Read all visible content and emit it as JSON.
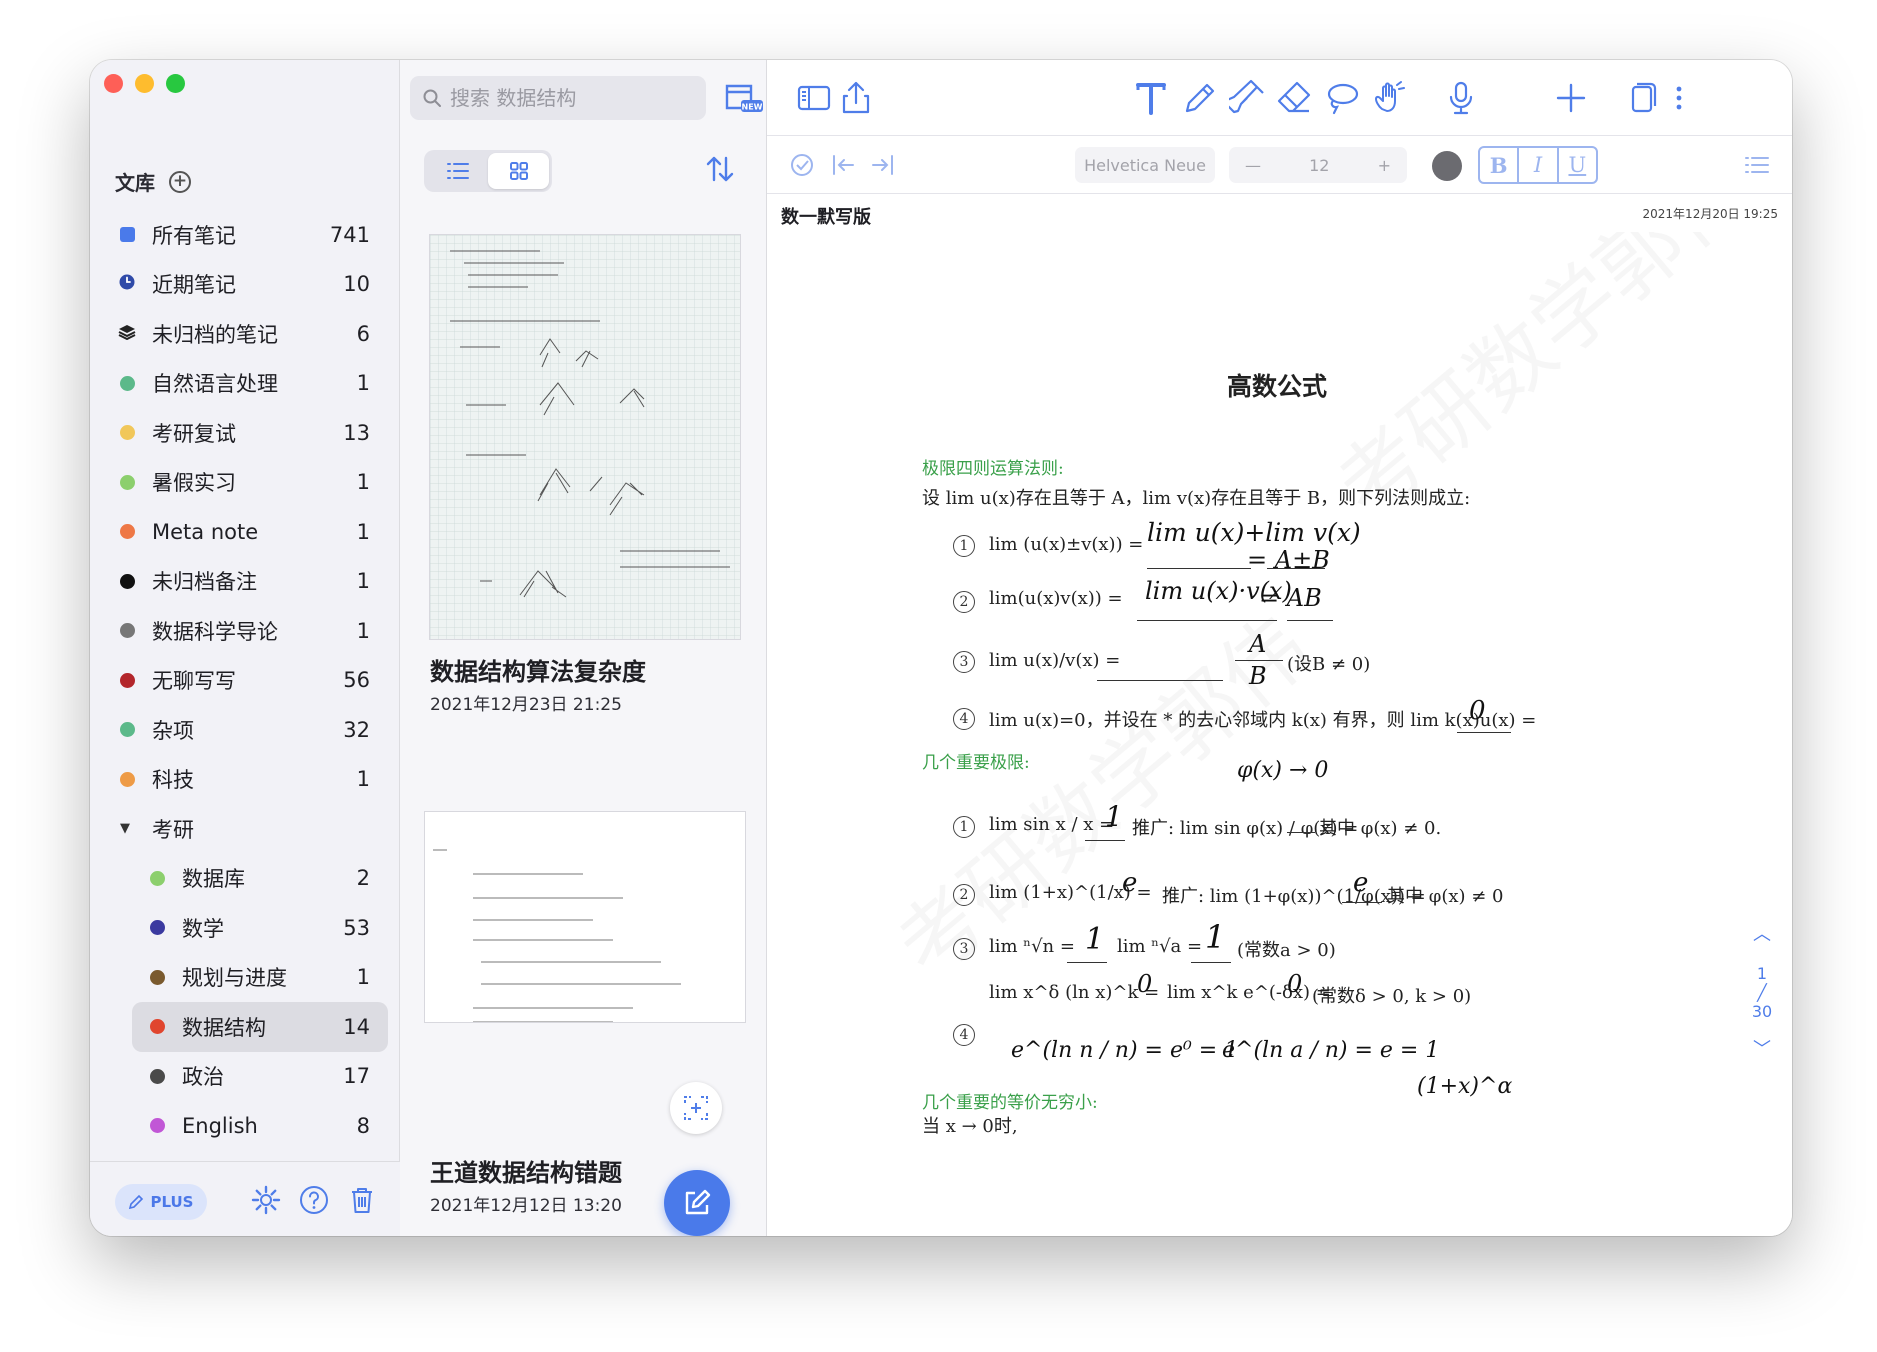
{
  "sidebar": {
    "library_label": "文库",
    "items": [
      {
        "label": "所有笔记",
        "count": "741",
        "marker": "square",
        "color": "#4a7aea"
      },
      {
        "label": "近期笔记",
        "count": "10",
        "marker": "clock",
        "color": "#2f4aa8"
      },
      {
        "label": "未归档的笔记",
        "count": "6",
        "marker": "stack",
        "color": "#222222"
      },
      {
        "label": "自然语言处理",
        "count": "1",
        "marker": "dot",
        "color": "#5cb98a"
      },
      {
        "label": "考研复试",
        "count": "13",
        "marker": "dot",
        "color": "#f1c75a"
      },
      {
        "label": "暑假实习",
        "count": "1",
        "marker": "dot",
        "color": "#8ccf6d"
      },
      {
        "label": "Meta note",
        "count": "1",
        "marker": "dot",
        "color": "#ee7846"
      },
      {
        "label": "未归档备注",
        "count": "1",
        "marker": "dot",
        "color": "#111111"
      },
      {
        "label": "数据科学导论",
        "count": "1",
        "marker": "dot",
        "color": "#777777"
      },
      {
        "label": "无聊写写",
        "count": "56",
        "marker": "dot",
        "color": "#b3262b"
      },
      {
        "label": "杂项",
        "count": "32",
        "marker": "dot",
        "color": "#5cb98a"
      },
      {
        "label": "科技",
        "count": "1",
        "marker": "dot",
        "color": "#ee9b46"
      }
    ],
    "group": {
      "label": "考研",
      "expanded": true
    },
    "children": [
      {
        "label": "数据库",
        "count": "2",
        "color": "#8ccf6d"
      },
      {
        "label": "数学",
        "count": "53",
        "color": "#3b3aa0"
      },
      {
        "label": "规划与进度",
        "count": "1",
        "color": "#7a5a2e"
      },
      {
        "label": "数据结构",
        "count": "14",
        "color": "#e0452e",
        "selected": true
      },
      {
        "label": "政治",
        "count": "17",
        "color": "#4a4a4a"
      },
      {
        "label": "English",
        "count": "8",
        "color": "#c157d6"
      }
    ],
    "plus_label": "PLUS"
  },
  "notelist": {
    "search_placeholder": "搜索 数据结构",
    "notes": [
      {
        "title": "数据结构算法复杂度",
        "date": "2021年12月23日 21:25"
      },
      {
        "title": "王道数据结构错题",
        "date": "2021年12月12日 13:20"
      }
    ]
  },
  "editor": {
    "font_name": "Helvetica Neue",
    "font_size": "12",
    "format_bold": "B",
    "format_italic": "I",
    "format_underline": "U",
    "doc_title": "数一默写版",
    "doc_date": "2021年12月20日 19:25",
    "page_current": "1",
    "page_total": "30"
  },
  "paper": {
    "heading": "高数公式",
    "section1": "极限四则运算法则:",
    "intro": "设 lim u(x)存在且等于 A，lim v(x)存在且等于 B，则下列法则成立:",
    "r1": "lim (u(x)±v(x)) =",
    "r2": "lim(u(x)v(x)) =",
    "r3": "lim u(x)/v(x) =",
    "r3_cond": "(设B ≠ 0)",
    "r4": "lim u(x)=0，并设在 * 的去心邻域内 k(x) 有界，则 lim k(x)u(x) =",
    "section2": "几个重要极限:",
    "e1": "lim sin x / x =",
    "e1_ext": "推广: lim sin φ(x) / φ(x) =",
    "e1_cond": "其中 φ(x) ≠ 0.",
    "e2": "lim (1+x)^(1/x) =",
    "e2_ext": "推广: lim (1+φ(x))^(1/φ(x)) =",
    "e2_cond": "其中 φ(x) ≠ 0",
    "e3": "lim ⁿ√n =",
    "e3b": "lim ⁿ√a =",
    "e3_cond": "(常数a > 0)",
    "e3c": "lim x^δ (ln x)^k =",
    "e3d": "lim x^k e^(-δx) =",
    "e3_cond2": "(常数δ > 0, k > 0)",
    "section3": "几个重要的等价无穷小:",
    "last_line": "当 x → 0时,",
    "hw_1": "lim u(x)+lim v(x)",
    "hw_1b": "= A±B",
    "hw_2": "lim u(x)·v(x)",
    "hw_2b": "= AB",
    "hw_3": "A",
    "hw_3b": "B",
    "hw_4": "0",
    "hw_5": "φ(x) → 0",
    "hw_6": "1",
    "hw_7": "e",
    "hw_7b": "e",
    "hw_8": "1",
    "hw_8b": "1",
    "hw_9": "0",
    "hw_9b": "0",
    "hw_10": "e^(ln n / n) = e⁰ = 1",
    "hw_10b": "e^(ln a / n) = e = 1",
    "hw_11": "(1+x)^α",
    "wm1": "考研数学郭伟",
    "wm2": "考研数学郭伟"
  }
}
